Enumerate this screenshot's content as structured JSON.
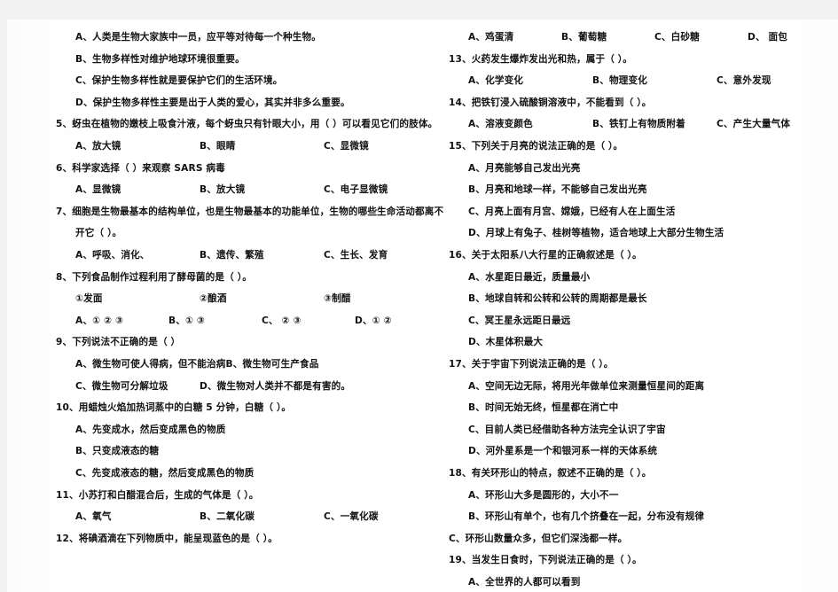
{
  "document": {
    "type": "scanned-exam-paper",
    "subject_language": "Chinese",
    "page_background": "#ffffff",
    "surround_background": "#f2f2f2",
    "text_color": "#121212"
  },
  "left_column": [
    {
      "kind": "option",
      "indent": "opt",
      "text": "A、人类是生物大家族中一员，应平等对待每一个种生物。"
    },
    {
      "kind": "option",
      "indent": "opt",
      "text": "B、生物多样性对维护地球环境很重要。"
    },
    {
      "kind": "option",
      "indent": "opt",
      "text": "C、保护生物多样性就是要保护它们的生活环境。"
    },
    {
      "kind": "option",
      "indent": "opt",
      "text": "D、保护生物多样性主要是出于人类的爱心，其实并非多么重要。"
    },
    {
      "kind": "stem",
      "indent": "stem",
      "text": "5、蚜虫在植物的嫩枝上吸食汁液，每个蚜虫只有针眼大小，用（    ）可以看见它们的肢体。"
    },
    {
      "kind": "optrow",
      "cells": [
        "A、放大镜",
        "B、眼睛",
        "C、显微镜"
      ]
    },
    {
      "kind": "stem",
      "indent": "stem",
      "text": "6、科学家选择（        ）来观察 SARS 病毒"
    },
    {
      "kind": "optrow",
      "cells": [
        "A、显微镜",
        "B、放大镜",
        "C、电子显微镜"
      ]
    },
    {
      "kind": "stem",
      "indent": "stem",
      "text": "7、细胞是生物最基本的结构单位，也是生物最基本的功能单位，生物的哪些生命活动都离不"
    },
    {
      "kind": "cont",
      "indent": "cont",
      "text": "开它（       ）。"
    },
    {
      "kind": "optrow",
      "cells": [
        "A、呼吸、消化、",
        "B、遗传、繁殖",
        "C、生长、发育"
      ]
    },
    {
      "kind": "stem",
      "indent": "stem",
      "text": "8、下列食品制作过程利用了酵母菌的是（        ）。"
    },
    {
      "kind": "optrow",
      "cells": [
        "①发面",
        "②酿酒",
        "③制醋"
      ]
    },
    {
      "kind": "optrow",
      "cells": [
        "A、① ② ③",
        "B、①  ③",
        "C、 ② ③",
        "D、① ②"
      ]
    },
    {
      "kind": "stem",
      "indent": "stem",
      "text": "9、下列说法不正确的是（      ）"
    },
    {
      "kind": "optrow",
      "cells": [
        "A、微生物可使人得病，但不能治病",
        "B、微生物可生产食品"
      ]
    },
    {
      "kind": "optrow",
      "cells": [
        "C、微生物可分解垃圾",
        "D、微生物对人类并不都是有害的。"
      ]
    },
    {
      "kind": "stem",
      "indent": "stem",
      "text": "10、用蜡烛火焰加热词蒸中的白糖 5 分钟，白糖（        ）。"
    },
    {
      "kind": "option",
      "indent": "opt",
      "text": "A、先变成水，然后变成黑色的物质"
    },
    {
      "kind": "option",
      "indent": "opt",
      "text": "B、只变成液态的糖"
    },
    {
      "kind": "option",
      "indent": "opt",
      "text": "C、先变成液态的糖，然后变成黑色的物质"
    },
    {
      "kind": "stem",
      "indent": "stem",
      "text": "11、小苏打和白醋混合后，生成的气体是（         ）。"
    },
    {
      "kind": "optrow",
      "cells": [
        "A、氧气",
        "B、二氧化碳",
        "C、一氧化碳"
      ]
    },
    {
      "kind": "stem",
      "indent": "stem",
      "text": "12、将碘酒滴在下列物质中，能呈现蓝色的是（         ）。"
    }
  ],
  "right_column": [
    {
      "kind": "optrow",
      "cells": [
        "A、鸡蛋清",
        "B、葡萄糖",
        "C、白砂糖",
        "D、 面包"
      ]
    },
    {
      "kind": "stem",
      "indent": "stem",
      "text": "13、火药发生爆炸发出光和热，属于（        ）。"
    },
    {
      "kind": "optrow",
      "cells": [
        "A、化学变化",
        "B、物理变化",
        "C、意外发现"
      ]
    },
    {
      "kind": "stem",
      "indent": "stem",
      "text": "14、把铁钉浸入硫酸铜溶液中，不能看到（        ）。"
    },
    {
      "kind": "optrow",
      "cells": [
        "A、溶液变颜色",
        "B、铁钉上有物质附着",
        "C、产生大量气体"
      ]
    },
    {
      "kind": "stem",
      "indent": "stem",
      "text": "15、下列关于月亮的说法正确的是（        ）。"
    },
    {
      "kind": "option",
      "indent": "opt",
      "text": "A、月亮能够自己发出光亮"
    },
    {
      "kind": "option",
      "indent": "opt",
      "text": "B、月亮和地球一样，不能够自己发出光亮"
    },
    {
      "kind": "option",
      "indent": "opt",
      "text": "C、月亮上面有月宫、嫦娥，已经有人在上面生活"
    },
    {
      "kind": "option",
      "indent": "opt",
      "text": "D、月球上有兔子、桂树等植物，适合地球上大部分生物生活"
    },
    {
      "kind": "stem",
      "indent": "stem",
      "text": "16、关于太阳系八大行星的正确叙述是（        ）。"
    },
    {
      "kind": "option",
      "indent": "opt",
      "text": "A、水星距日最近，质量最小"
    },
    {
      "kind": "option",
      "indent": "opt",
      "text": "B、地球自转和公转和公转的周期都是最长"
    },
    {
      "kind": "option",
      "indent": "opt",
      "text": "C、冥王星永远距日最远"
    },
    {
      "kind": "option",
      "indent": "opt",
      "text": "D、木星体积最大"
    },
    {
      "kind": "stem",
      "indent": "stem",
      "text": "17、关于宇宙下列说法正确的是（        ）。"
    },
    {
      "kind": "option",
      "indent": "opt",
      "text": "A、空间无边无际，将用光年做单位来测量恒星间的距离"
    },
    {
      "kind": "option",
      "indent": "opt",
      "text": "B、时间无始无终，恒星都在消亡中"
    },
    {
      "kind": "option",
      "indent": "opt",
      "text": "C、目前人类已经借助各种方法完全认识了宇宙"
    },
    {
      "kind": "option",
      "indent": "opt",
      "text": "D、河外星系是一个和银河系一样的天体系统"
    },
    {
      "kind": "stem",
      "indent": "stem",
      "text": "18、有关环形山的特点，叙述不正确的是（        ）。"
    },
    {
      "kind": "option",
      "indent": "opt",
      "text": "A、环形山大多是圆形的，大小不一"
    },
    {
      "kind": "option",
      "indent": "opt",
      "text": "B、环形山有单个，也有几个挤叠在一起，分布没有规律"
    },
    {
      "kind": "option",
      "indent": "stem",
      "text": "C、环形山数量众多，但它们深浅都一样。"
    },
    {
      "kind": "stem",
      "indent": "stem",
      "text": "19、当发生日食时，下列说法正确的是（        ）。"
    },
    {
      "kind": "option",
      "indent": "opt",
      "text": "A、全世界的人都可以看到"
    }
  ]
}
